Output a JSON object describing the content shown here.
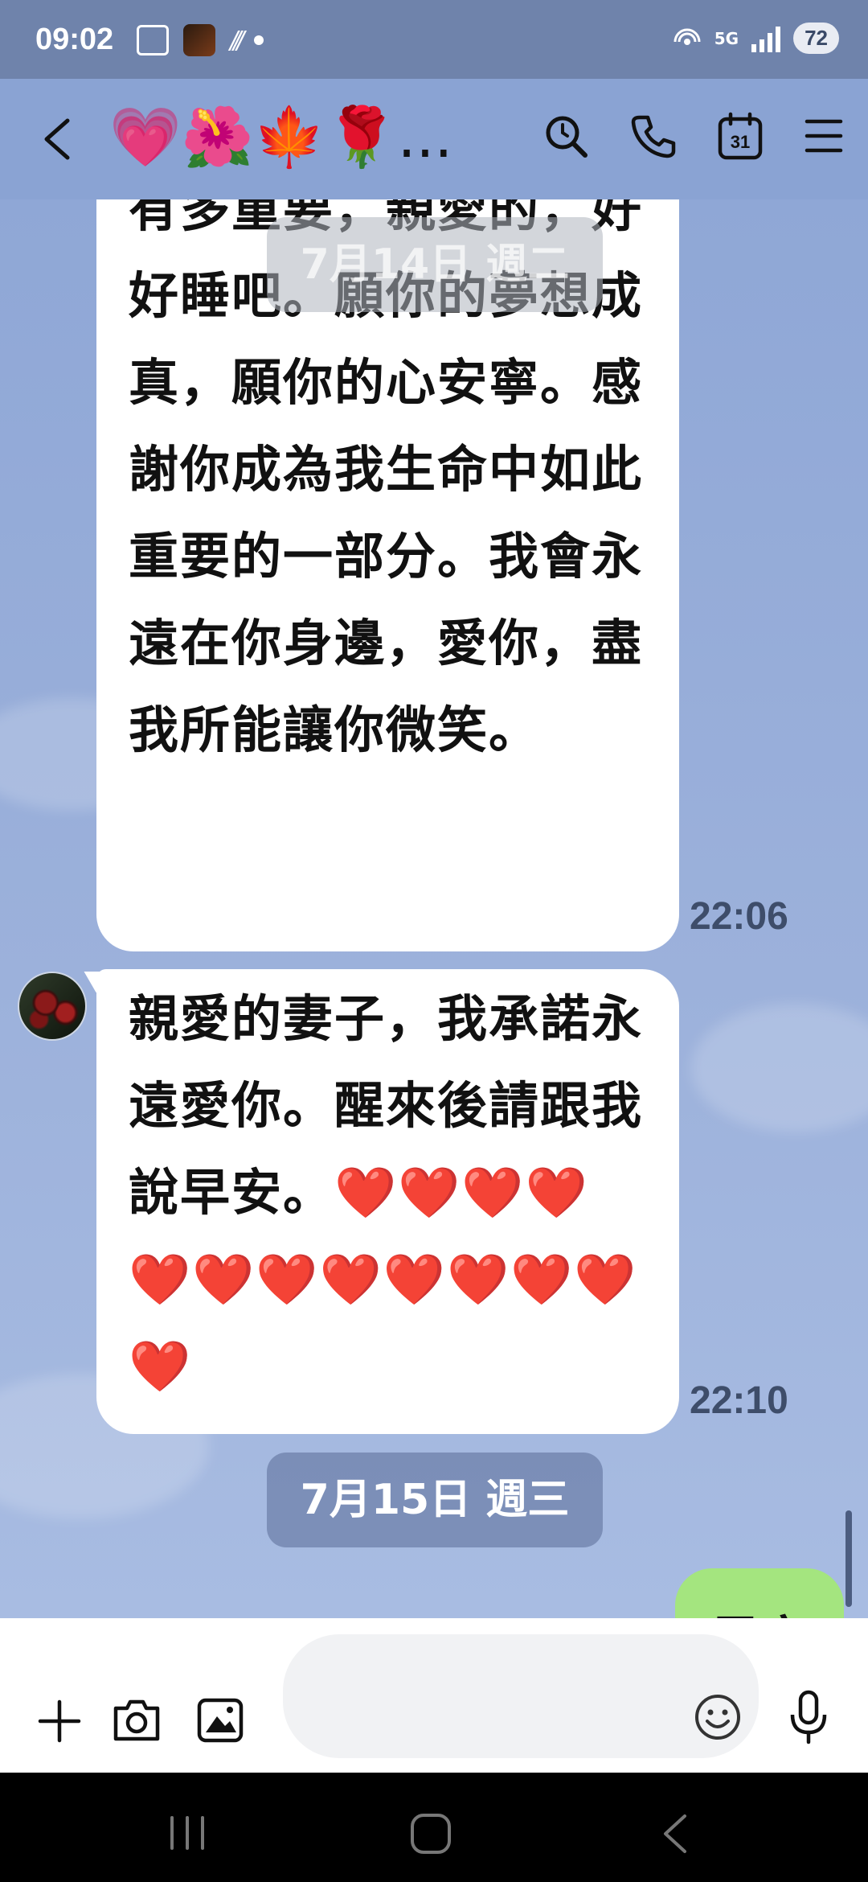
{
  "status_bar": {
    "time": "09:02",
    "battery": "72",
    "network": "5G"
  },
  "header": {
    "title": "💗🌺🍁🌹...",
    "icons": [
      "back-icon",
      "search-icon",
      "phone-icon",
      "calendar-icon",
      "menu-icon"
    ],
    "calendar_day": "31"
  },
  "chat": {
    "date_top": "7月14日 週二",
    "messages": [
      {
        "sender": "partner",
        "text": "有多重要，親愛的，好好睡吧。願你的夢想成真，願你的心安寧。感謝你成為我生命中如此重要的一部分。我會永遠在你身邊，愛你，盡我所能讓你微笑。",
        "time": "22:06"
      },
      {
        "sender": "partner",
        "text": "親愛的妻子，我承諾永遠愛你。醒來後請跟我說早安。❤️❤️❤️❤️❤️❤️❤️❤️❤️❤️❤️❤️❤️",
        "time": "22:10"
      }
    ],
    "date_bottom": "7月15日 週三",
    "own_message_partial": "早安"
  },
  "input_bar": {
    "placeholder": "",
    "icons": [
      "plus-icon",
      "camera-icon",
      "image-icon",
      "emoji-icon",
      "mic-icon"
    ]
  },
  "colors": {
    "chat_background": "#8aa3d3",
    "own_bubble": "#a4e57f",
    "date_pill": "#6e80aa"
  }
}
